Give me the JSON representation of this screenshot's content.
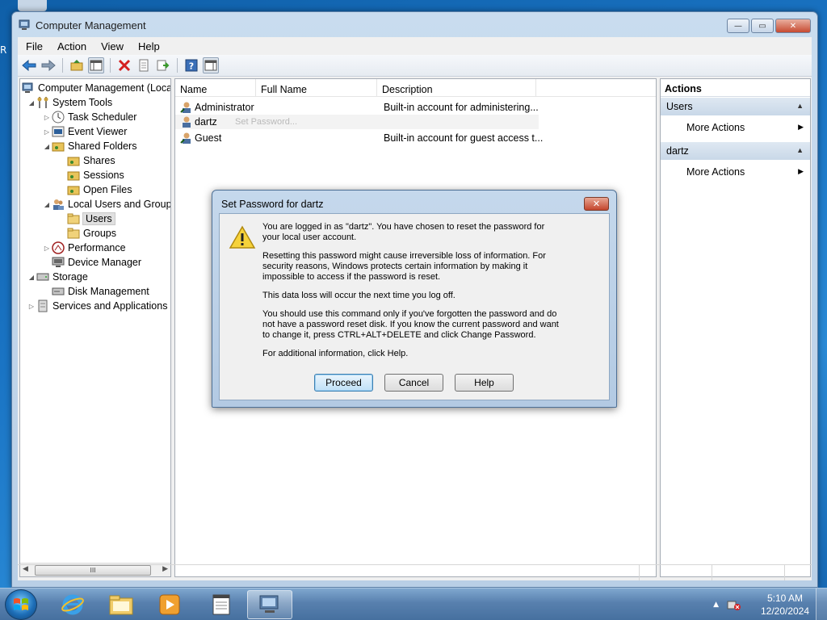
{
  "window": {
    "title": "Computer Management",
    "controls": {
      "minimize": "—",
      "maximize": "▭",
      "close": "✕"
    }
  },
  "menubar": [
    "File",
    "Action",
    "View",
    "Help"
  ],
  "toolbar": [
    "back-icon",
    "forward-icon",
    "up-folder-icon",
    "show-hide-tree-icon",
    "delete-icon",
    "properties-icon",
    "export-icon",
    "help-icon",
    "show-hide-action-pane-icon"
  ],
  "tree": {
    "root": "Computer Management (Local",
    "system_tools": "System Tools",
    "task_scheduler": "Task Scheduler",
    "event_viewer": "Event Viewer",
    "shared_folders": "Shared Folders",
    "shares": "Shares",
    "sessions": "Sessions",
    "open_files": "Open Files",
    "local_users": "Local Users and Groups",
    "users": "Users",
    "groups": "Groups",
    "performance": "Performance",
    "device_manager": "Device Manager",
    "storage": "Storage",
    "disk_management": "Disk Management",
    "services": "Services and Applications",
    "scroll_thumb": "III"
  },
  "list": {
    "columns": [
      "Name",
      "Full Name",
      "Description"
    ],
    "rows": [
      {
        "name": "Administrator",
        "full_name": "",
        "description": "Built-in account for administering..."
      },
      {
        "name": "dartz",
        "full_name": "",
        "description": ""
      },
      {
        "name": "Guest",
        "full_name": "",
        "description": "Built-in account for guest access t..."
      }
    ],
    "ghost_menu": "Set Password..."
  },
  "actions": {
    "title": "Actions",
    "section1": "Users",
    "section1_item": "More Actions",
    "section2": "dartz",
    "section2_item": "More Actions"
  },
  "dialog": {
    "title": "Set Password for dartz",
    "p1": "You are logged in as \"dartz\". You have chosen to reset the password for your local user account.",
    "p2": "Resetting this password might cause irreversible loss of information. For security reasons, Windows protects certain information by making it impossible to access if the password is reset.",
    "p3": "This data loss will occur the next time you log off.",
    "p4": "You should use this command only if you've forgotten the password and do not have a password reset disk. If you know the current password and want to change it, press CTRL+ALT+DELETE and click Change Password.",
    "p5": "For additional information, click Help.",
    "proceed": "Proceed",
    "cancel": "Cancel",
    "help": "Help",
    "close_glyph": "✕"
  },
  "taskbar": {
    "time": "5:10 AM",
    "date": "12/20/2024",
    "tray_arrow": "▲"
  },
  "colors": {
    "accent": "#3c7fb1",
    "titlebar": "#c9dcef",
    "close_red": "#c74a31"
  }
}
